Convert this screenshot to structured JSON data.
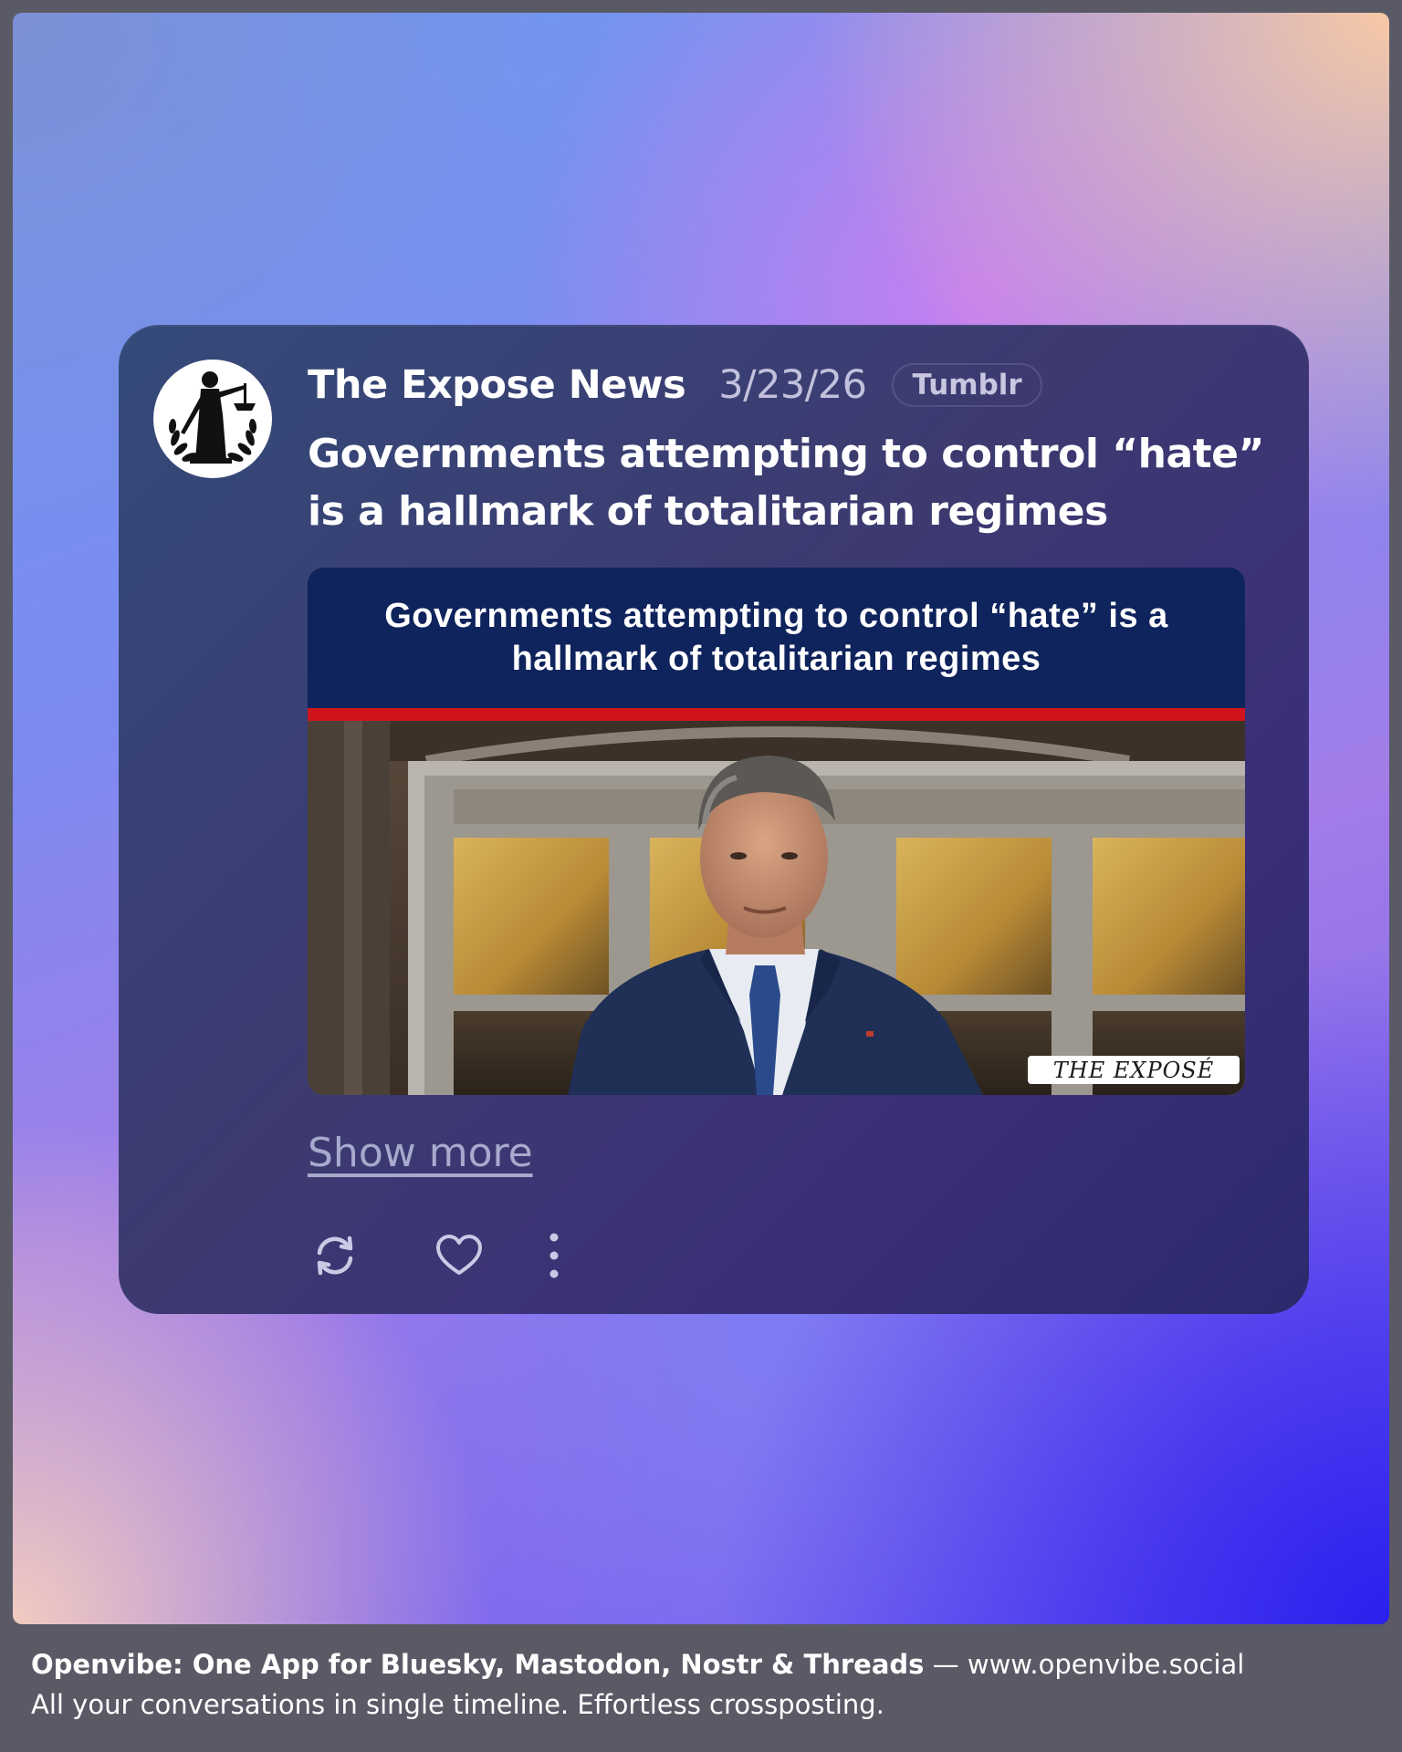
{
  "post": {
    "author": "The Expose News",
    "date": "3/23/26",
    "network": "Tumblr",
    "title": "Governments attempting to control “hate” is a hallmark of totalitarian regimes",
    "media": {
      "banner_text": "Governments attempting to control “hate” is a hallmark of totalitarian regimes",
      "watermark": "THE EXPOSÉ"
    },
    "show_more": "Show more",
    "actions": [
      {
        "icon": "repost-icon"
      },
      {
        "icon": "heart-icon"
      },
      {
        "icon": "more-vertical-icon"
      }
    ]
  },
  "footer": {
    "brand_line": "Openvibe: One App for Bluesky, Mastodon, Nostr & Threads",
    "separator": " — ",
    "url": "www.openvibe.social",
    "tagline": "All your conversations in single timeline. Effortless crossposting."
  },
  "colors": {
    "banner_navy": "#0f235c",
    "banner_red": "#d0141e",
    "card_bg": "#3d3a70"
  }
}
